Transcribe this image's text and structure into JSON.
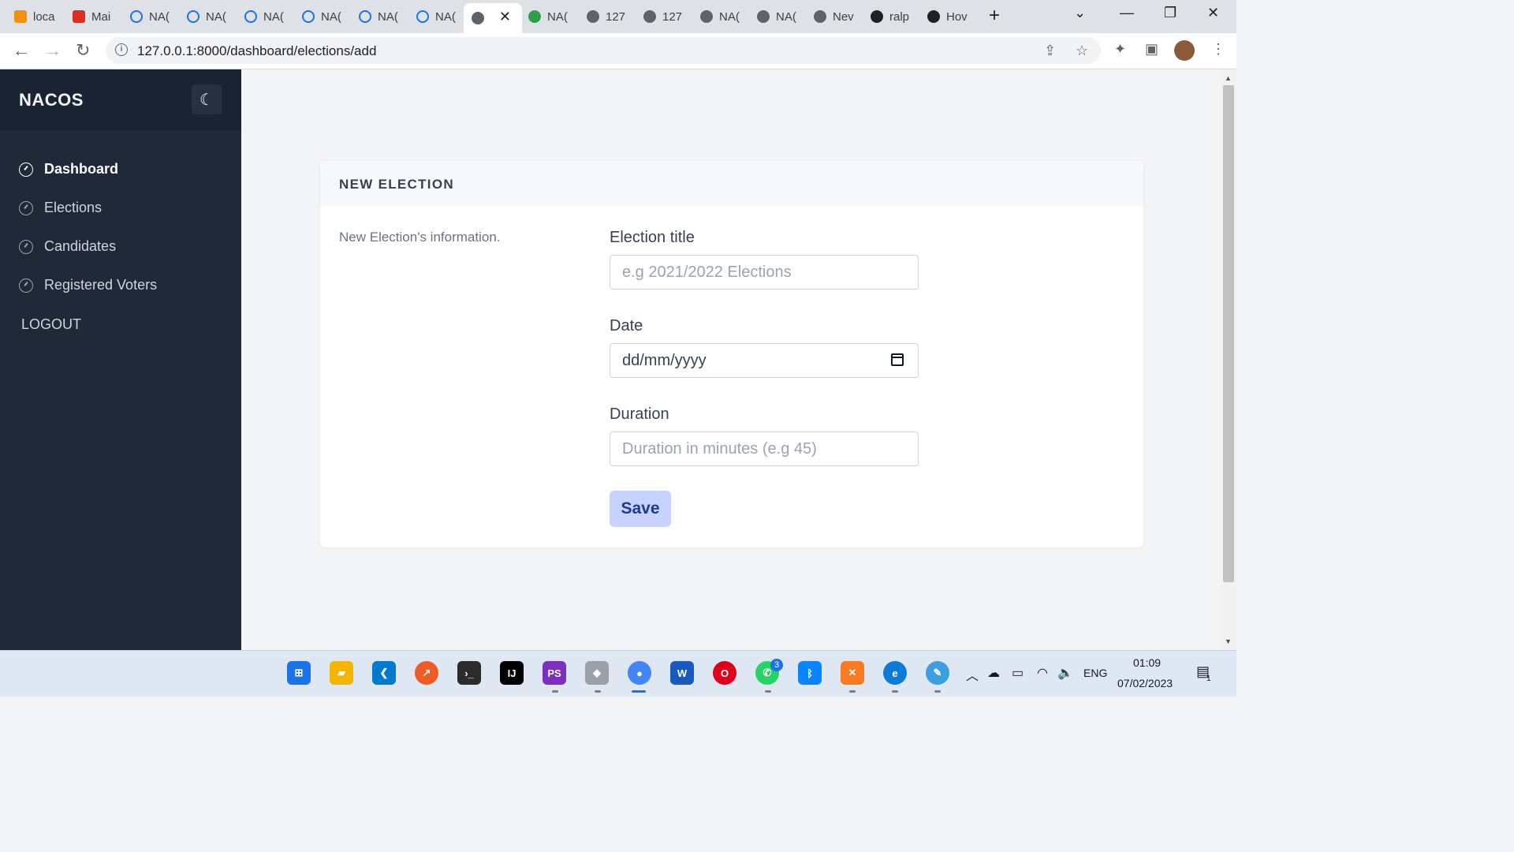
{
  "browser": {
    "tabs": [
      {
        "label": "loca",
        "favicon": "pma-icon",
        "color": "#f29111"
      },
      {
        "label": "Mai",
        "favicon": "mail-icon",
        "color": "#d93025"
      },
      {
        "label": "NA(",
        "favicon": "loading-ring-icon",
        "color": "#1a73e8"
      },
      {
        "label": "NA(",
        "favicon": "loading-ring-icon",
        "color": "#1a73e8"
      },
      {
        "label": "NA(",
        "favicon": "loading-ring-icon",
        "color": "#1a73e8"
      },
      {
        "label": "NA(",
        "favicon": "loading-ring-icon",
        "color": "#1a73e8"
      },
      {
        "label": "NA(",
        "favicon": "loading-ring-icon",
        "color": "#1a73e8"
      },
      {
        "label": "NA(",
        "favicon": "loading-ring-icon",
        "color": "#1a73e8"
      },
      {
        "label": "",
        "favicon": "globe-icon",
        "color": "#5f6368",
        "active": true
      },
      {
        "label": "NA(",
        "favicon": "shield-icon",
        "color": "#2e9e4a"
      },
      {
        "label": "127",
        "favicon": "globe-icon",
        "color": "#5f6368"
      },
      {
        "label": "127",
        "favicon": "globe-icon",
        "color": "#5f6368"
      },
      {
        "label": "NA(",
        "favicon": "globe-icon",
        "color": "#5f6368"
      },
      {
        "label": "NA(",
        "favicon": "globe-icon",
        "color": "#5f6368"
      },
      {
        "label": "Nev",
        "favicon": "globe-icon",
        "color": "#5f6368"
      },
      {
        "label": "ralp",
        "favicon": "github-icon",
        "color": "#202124"
      },
      {
        "label": "Hov",
        "favicon": "github-icon",
        "color": "#202124"
      }
    ],
    "new_tab": "+",
    "url": "127.0.0.1:8000/dashboard/elections/add"
  },
  "sidebar": {
    "brand": "NACOS",
    "theme_toggle": "☾",
    "items": [
      {
        "label": "Dashboard",
        "active": true
      },
      {
        "label": "Elections",
        "active": false
      },
      {
        "label": "Candidates",
        "active": false
      },
      {
        "label": "Registered Voters",
        "active": false
      }
    ],
    "logout": "LOGOUT"
  },
  "card": {
    "title": "NEW ELECTION",
    "description": "New Election's information.",
    "fields": {
      "title": {
        "label": "Election title",
        "placeholder": "e.g 2021/2022 Elections"
      },
      "date": {
        "label": "Date",
        "placeholder": "dd/mm/yyyy"
      },
      "duration": {
        "label": "Duration",
        "placeholder": "Duration in minutes (e.g 45)"
      }
    },
    "save_label": "Save"
  },
  "taskbar": {
    "apps": [
      {
        "name": "windows-start-icon",
        "color": "#1a73e8"
      },
      {
        "name": "file-explorer-icon",
        "color": "#f4b400"
      },
      {
        "name": "vscode-icon",
        "color": "#007acc"
      },
      {
        "name": "postman-icon",
        "color": "#ef5b25"
      },
      {
        "name": "terminal-icon",
        "color": "#2b2b2b"
      },
      {
        "name": "intellij-icon",
        "color": "#000000"
      },
      {
        "name": "phpstorm-icon",
        "color": "#7b2fbe"
      },
      {
        "name": "gitkraken-icon",
        "color": "#9aa0a6"
      },
      {
        "name": "chrome-icon",
        "color": "#4285f4"
      },
      {
        "name": "word-icon",
        "color": "#185abd"
      },
      {
        "name": "opera-icon",
        "color": "#e0001b"
      },
      {
        "name": "whatsapp-icon",
        "color": "#25d366"
      },
      {
        "name": "bluetooth-icon",
        "color": "#0a84ff"
      },
      {
        "name": "xampp-icon",
        "color": "#fb7a24"
      },
      {
        "name": "edge-icon",
        "color": "#0c7bd8"
      },
      {
        "name": "paint-icon",
        "color": "#3aa0e0"
      }
    ],
    "whatsapp_badge": "3",
    "language": "ENG",
    "time": "01:09",
    "date": "07/02/2023",
    "notification_count": "1"
  },
  "colors": {
    "sidebar_bg": "#1f2937",
    "main_bg": "#f3f4f6",
    "save_bg": "#c7d2fe",
    "save_text": "#1e3a8a"
  }
}
